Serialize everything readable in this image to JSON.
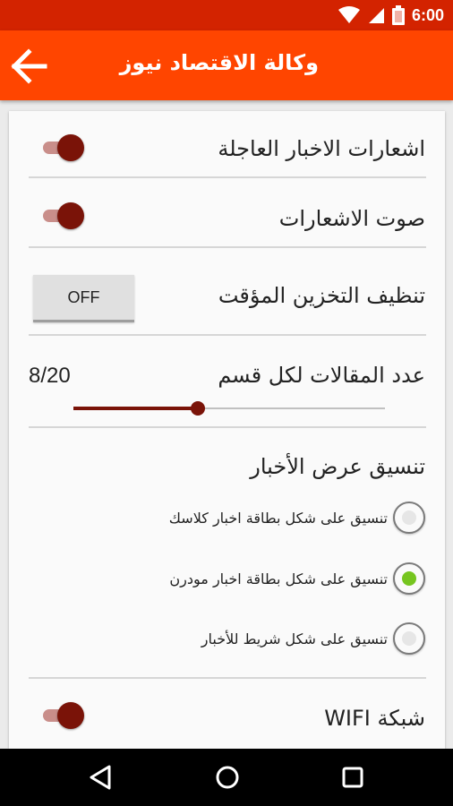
{
  "status": {
    "time": "6:00"
  },
  "appbar": {
    "title": "وكالة الاقتصاد نيوز"
  },
  "settings": {
    "breaking_news_label": "اشعارات الاخبار العاجلة",
    "notification_sound_label": "صوت الاشعارات",
    "clear_cache_label": "تنظيف التخزين المؤقت",
    "clear_cache_button": "OFF",
    "articles_per_section_label": "عدد المقالات لكل قسم",
    "articles_per_section_value": "8/20",
    "articles_per_section_fraction": 0.4,
    "layout_title": "تنسيق عرض الأخبار",
    "layout_options": [
      {
        "label": "تنسيق على شكل بطاقة اخبار كلاسك",
        "selected": false
      },
      {
        "label": "تنسيق على شكل بطاقة اخبار مودرن",
        "selected": true
      },
      {
        "label": "تنسيق على شكل شريط للأخبار",
        "selected": false
      }
    ],
    "wifi_label": "شبكة WIFI"
  },
  "colors": {
    "statusbar": "#d32300",
    "appbar": "#ff4500",
    "accent": "#7a1308",
    "radio_selected": "#76c51f"
  }
}
